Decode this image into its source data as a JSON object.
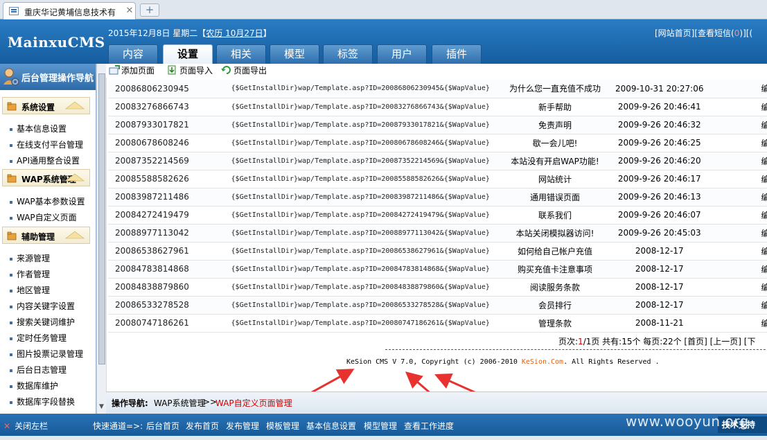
{
  "browser": {
    "tab_title": "重庆华记黄埔信息技术有",
    "tab_close": "✕",
    "new_tab": "+"
  },
  "header": {
    "logo": "MainxuCMS",
    "date_text": "2015年12月8日 星期二【",
    "lunar_text": "农历 10月27日",
    "date_close": "】",
    "links": {
      "site_home": "[网站首页]",
      "messages": "[查看短信(",
      "messages_count": "0",
      "messages_close": ")]",
      "more": "[("
    },
    "tabs": [
      "内容",
      "设置",
      "相关",
      "模型",
      "标签",
      "用户",
      "插件"
    ],
    "active_tab_index": 1
  },
  "sidebar": {
    "title": "后台管理操作导航",
    "groups": [
      {
        "title": "系统设置",
        "items": [
          "基本信息设置",
          "在线支付平台管理",
          "API通用整合设置"
        ]
      },
      {
        "title": "WAP系统管理",
        "items": [
          "WAP基本参数设置",
          "WAP自定义页面"
        ]
      },
      {
        "title": "辅助管理",
        "items": [
          "来源管理",
          "作者管理",
          "地区管理",
          "内容关键字设置",
          "搜索关键词维护",
          "定时任务管理",
          "图片投票记录管理",
          "后台日志管理",
          "数据库维护",
          "数据库字段替换"
        ]
      }
    ]
  },
  "toolbar": {
    "add": "添加页面",
    "import": "页面导入",
    "export": "页面导出"
  },
  "table": {
    "rows": [
      {
        "id": "20086806230945",
        "path": "{$GetInstallDir}wap/Template.asp?ID=20086806230945&{$WapValue}",
        "title": "为什么您一直充值不成功",
        "date": "2009-10-31 20:27:06",
        "extra": "编"
      },
      {
        "id": "20083276866743",
        "path": "{$GetInstallDir}wap/Template.asp?ID=20083276866743&{$WapValue}",
        "title": "新手帮助",
        "date": "2009-9-26 20:46:41",
        "extra": "编"
      },
      {
        "id": "20087933017821",
        "path": "{$GetInstallDir}wap/Template.asp?ID=20087933017821&{$WapValue}",
        "title": "免责声明",
        "date": "2009-9-26 20:46:32",
        "extra": "编"
      },
      {
        "id": "20080678608246",
        "path": "{$GetInstallDir}wap/Template.asp?ID=20080678608246&{$WapValue}",
        "title": "歇一会儿吧!",
        "date": "2009-9-26 20:46:25",
        "extra": "编"
      },
      {
        "id": "20087352214569",
        "path": "{$GetInstallDir}wap/Template.asp?ID=20087352214569&{$WapValue}",
        "title": "本站没有开启WAP功能!",
        "date": "2009-9-26 20:46:20",
        "extra": "编"
      },
      {
        "id": "20085588582626",
        "path": "{$GetInstallDir}wap/Template.asp?ID=20085588582626&{$WapValue}",
        "title": "网站统计",
        "date": "2009-9-26 20:46:17",
        "extra": "编"
      },
      {
        "id": "20083987211486",
        "path": "{$GetInstallDir}wap/Template.asp?ID=20083987211486&{$WapValue}",
        "title": "通用错误页面",
        "date": "2009-9-26 20:46:13",
        "extra": "编"
      },
      {
        "id": "20084272419479",
        "path": "{$GetInstallDir}wap/Template.asp?ID=20084272419479&{$WapValue}",
        "title": "联系我们",
        "date": "2009-9-26 20:46:07",
        "extra": "编"
      },
      {
        "id": "20088977113042",
        "path": "{$GetInstallDir}wap/Template.asp?ID=20088977113042&{$WapValue}",
        "title": "本站关闭模拟器访问!",
        "date": "2009-9-26 20:45:03",
        "extra": "编"
      },
      {
        "id": "20086538627961",
        "path": "{$GetInstallDir}wap/Template.asp?ID=20086538627961&{$WapValue}",
        "title": "如何给自己帐户充值",
        "date": "2008-12-17",
        "extra": "编"
      },
      {
        "id": "20084783814868",
        "path": "{$GetInstallDir}wap/Template.asp?ID=20084783814868&{$WapValue}",
        "title": "购买充值卡注意事项",
        "date": "2008-12-17",
        "extra": "编"
      },
      {
        "id": "20084838879860",
        "path": "{$GetInstallDir}wap/Template.asp?ID=20084838879860&{$WapValue}",
        "title": "阅读服务条款",
        "date": "2008-12-17",
        "extra": "编"
      },
      {
        "id": "20086533278528",
        "path": "{$GetInstallDir}wap/Template.asp?ID=20086533278528&{$WapValue}",
        "title": "会员排行",
        "date": "2008-12-17",
        "extra": "编"
      },
      {
        "id": "20080747186261",
        "path": "{$GetInstallDir}wap/Template.asp?ID=20080747186261&{$WapValue}",
        "title": "管理条款",
        "date": "2008-11-21",
        "extra": "编"
      }
    ]
  },
  "pager": {
    "prefix": "页次:",
    "current": "1",
    "rest": "/1页 共有:15个 每页:22个 [首页] [上一页] [下"
  },
  "footer": {
    "copyright_prefix": "KeSion CMS V 7.0, Copyright (c) 2006-2010 ",
    "brand": "KeSion.Com",
    "copyright_suffix": ". All Rights Reserved ."
  },
  "crumb": {
    "label": "操作导航:",
    "item1": "WAP系统管理",
    "sep": ">>",
    "item2": "WAP自定义页面管理"
  },
  "bottombar": {
    "close_left": "关闭左栏",
    "quick_label": "快速通道=>:",
    "links": [
      "后台首页",
      "发布首页",
      "发布管理",
      "模板管理",
      "基本信息设置",
      "模型管理",
      "查看工作进度"
    ],
    "tech_support": "技术支持"
  },
  "watermark": "www.wooyun.org",
  "colors": {
    "header_blue": "#1d6aae",
    "accent_red": "#d00000",
    "brand_orange": "#e06010",
    "annotation_red": "#e8322f"
  }
}
